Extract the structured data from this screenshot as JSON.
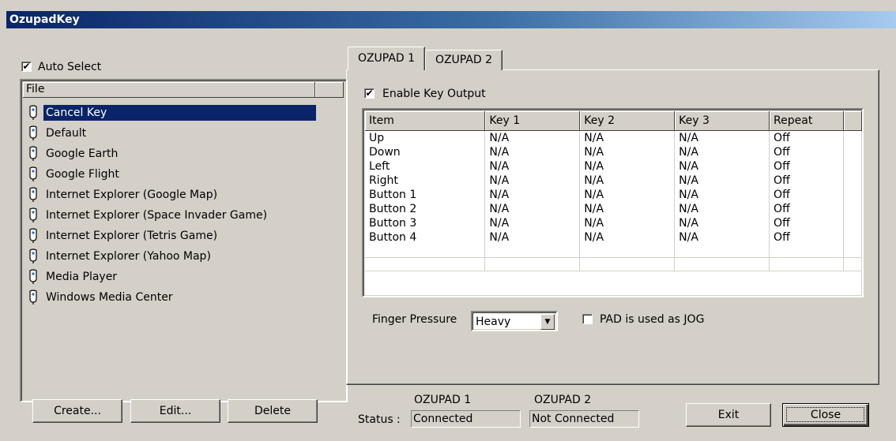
{
  "window": {
    "title": "OzupadKey"
  },
  "left": {
    "auto_select_label": "Auto Select",
    "auto_select_checked": true,
    "file_column": "File",
    "files": [
      {
        "label": "Cancel Key",
        "selected": true
      },
      {
        "label": "Default"
      },
      {
        "label": "Google Earth"
      },
      {
        "label": "Google Flight"
      },
      {
        "label": "Internet Explorer (Google Map)"
      },
      {
        "label": "Internet Explorer (Space Invader Game)"
      },
      {
        "label": "Internet Explorer (Tetris Game)"
      },
      {
        "label": "Internet Explorer (Yahoo Map)"
      },
      {
        "label": "Media Player"
      },
      {
        "label": "Windows Media Center"
      }
    ],
    "buttons": {
      "create": "Create...",
      "edit": "Edit...",
      "delete": "Delete"
    }
  },
  "tabs": [
    {
      "label": "OZUPAD 1",
      "active": true
    },
    {
      "label": "OZUPAD 2",
      "active": false
    }
  ],
  "panel": {
    "enable_key_output_label": "Enable Key Output",
    "enable_key_output_checked": true,
    "columns": [
      "Item",
      "Key 1",
      "Key 2",
      "Key 3",
      "Repeat"
    ],
    "rows": [
      [
        "Up",
        "N/A",
        "N/A",
        "N/A",
        "Off"
      ],
      [
        "Down",
        "N/A",
        "N/A",
        "N/A",
        "Off"
      ],
      [
        "Left",
        "N/A",
        "N/A",
        "N/A",
        "Off"
      ],
      [
        "Right",
        "N/A",
        "N/A",
        "N/A",
        "Off"
      ],
      [
        "Button 1",
        "N/A",
        "N/A",
        "N/A",
        "Off"
      ],
      [
        "Button 2",
        "N/A",
        "N/A",
        "N/A",
        "Off"
      ],
      [
        "Button 3",
        "N/A",
        "N/A",
        "N/A",
        "Off"
      ],
      [
        "Button 4",
        "N/A",
        "N/A",
        "N/A",
        "Off"
      ]
    ],
    "finger_pressure_label": "Finger Pressure",
    "finger_pressure_value": "Heavy",
    "pad_jog_label": "PAD is used as JOG",
    "pad_jog_checked": false
  },
  "status": {
    "label": "Status :",
    "pad1_title": "OZUPAD 1",
    "pad1_value": "Connected",
    "pad2_title": "OZUPAD 2",
    "pad2_value": "Not Connected"
  },
  "footer": {
    "exit": "Exit",
    "close": "Close"
  }
}
